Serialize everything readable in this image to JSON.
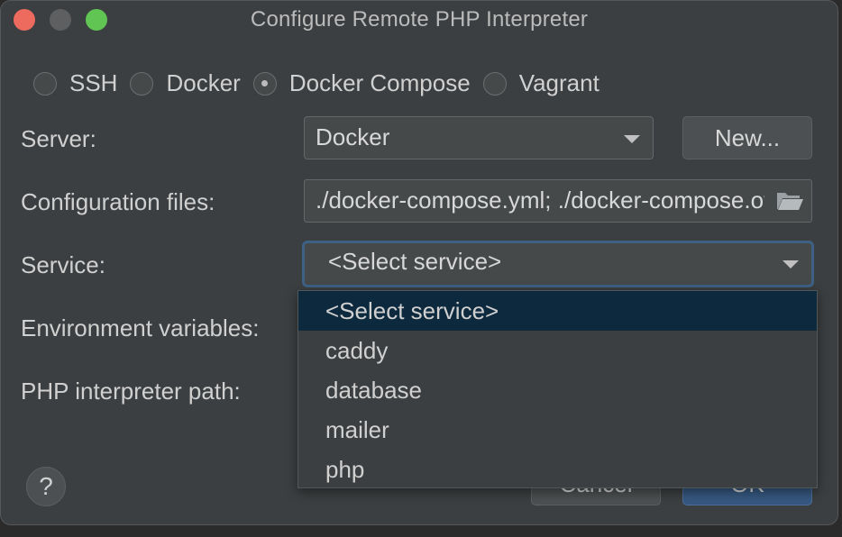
{
  "window": {
    "title": "Configure Remote PHP Interpreter"
  },
  "connection_types": [
    {
      "label": "SSH",
      "checked": false
    },
    {
      "label": "Docker",
      "checked": false
    },
    {
      "label": "Docker Compose",
      "checked": true
    },
    {
      "label": "Vagrant",
      "checked": false
    }
  ],
  "server": {
    "label": "Server:",
    "value": "Docker",
    "new_button": "New..."
  },
  "config_files": {
    "label": "Configuration files:",
    "value": "./docker-compose.yml; ./docker-compose.override.yml"
  },
  "service": {
    "label": "Service:",
    "value": "<Select service>",
    "options": [
      "<Select service>",
      "caddy",
      "database",
      "mailer",
      "php"
    ],
    "selected_index": 0
  },
  "env_vars": {
    "label": "Environment variables:"
  },
  "php_path": {
    "label": "PHP interpreter path:"
  },
  "footer": {
    "help_label": "?",
    "cancel_label": "Cancel",
    "ok_label": "OK"
  },
  "colors": {
    "background": "#3c3f41",
    "accent_focus": "#3d6185",
    "ok_button": "#365880",
    "selection": "#0d293e"
  }
}
